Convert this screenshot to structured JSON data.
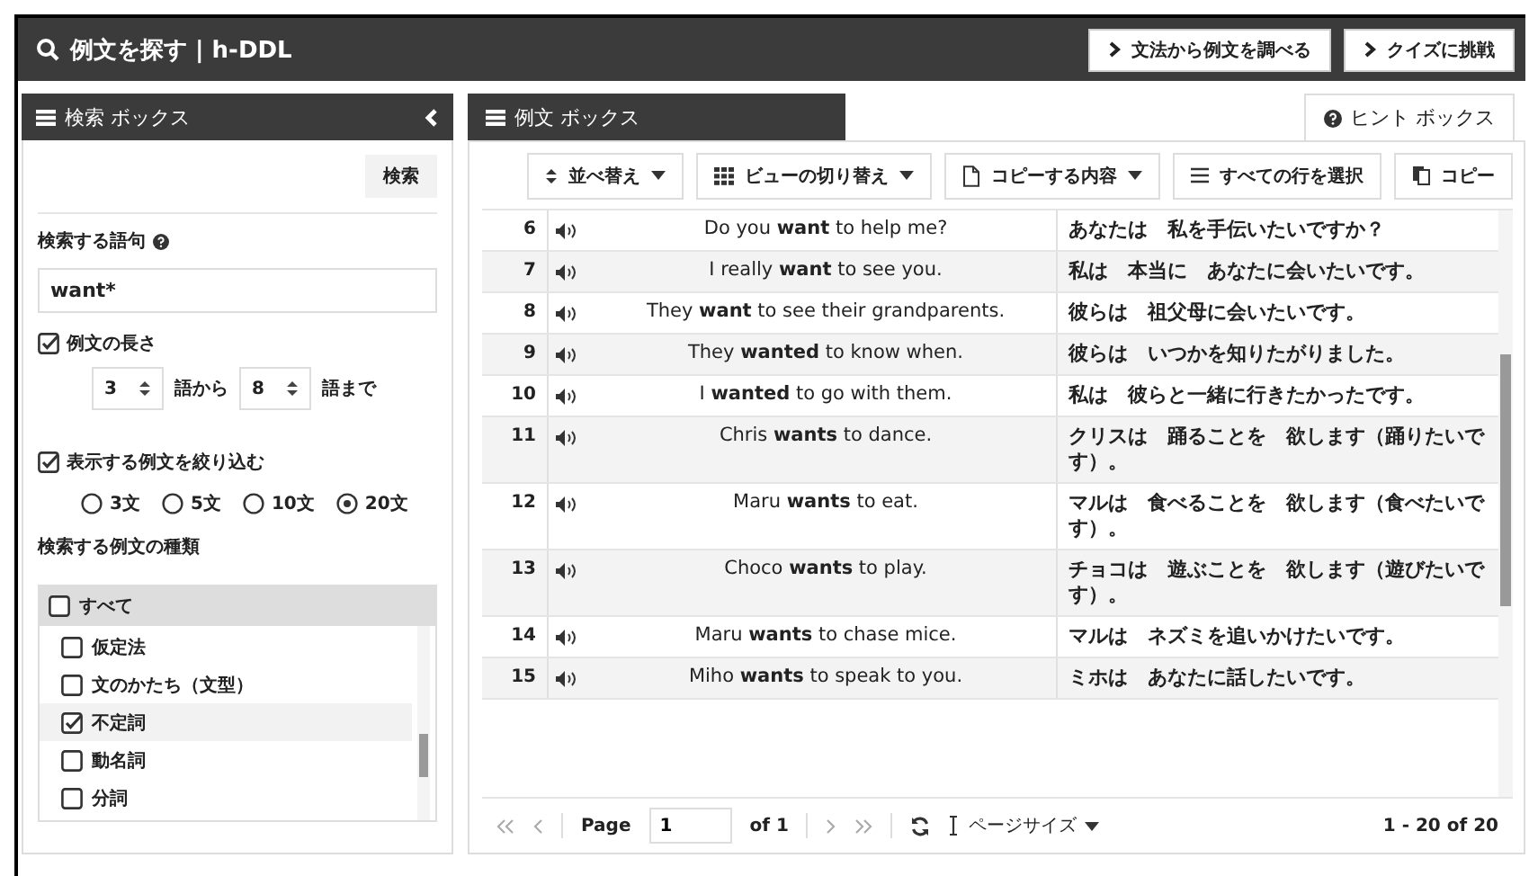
{
  "title": "例文を探す | h-DDL",
  "header_buttons": [
    "文法から例文を調べる",
    "クイズに挑戦"
  ],
  "search_panel": {
    "title": "検索 ボックス",
    "search_button": "検索",
    "term_label": "検索する語句",
    "term_value": "want*",
    "length": {
      "label": "例文の長さ",
      "checked": true,
      "from": "3",
      "from_unit": "語から",
      "to": "8",
      "to_unit": "語まで"
    },
    "limit": {
      "label": "表示する例文を絞り込む",
      "checked": true,
      "options": [
        {
          "label": "3文",
          "selected": false
        },
        {
          "label": "5文",
          "selected": false
        },
        {
          "label": "10文",
          "selected": false
        },
        {
          "label": "20文",
          "selected": true
        }
      ]
    },
    "types_label": "検索する例文の種類",
    "types_all": {
      "label": "すべて",
      "checked": false
    },
    "types": [
      {
        "label": "仮定法",
        "checked": false
      },
      {
        "label": "文のかたち（文型）",
        "checked": false
      },
      {
        "label": "不定詞",
        "checked": true
      },
      {
        "label": "動名詞",
        "checked": false
      },
      {
        "label": "分詞",
        "checked": false
      }
    ]
  },
  "results_panel": {
    "tabs": [
      {
        "label": "例文 ボックス",
        "selected": true
      },
      {
        "label": "ヒント ボックス",
        "selected": false
      }
    ],
    "toolbar": [
      {
        "label": "並べ替え",
        "kind": "sort",
        "menu": true
      },
      {
        "label": "ビューの切り替え",
        "kind": "view",
        "menu": true
      },
      {
        "label": "コピーする内容",
        "kind": "document",
        "menu": true
      },
      {
        "label": "すべての行を選択",
        "kind": "lines",
        "menu": false
      },
      {
        "label": "コピー",
        "kind": "copy",
        "menu": false
      }
    ],
    "rows": [
      {
        "num": "6",
        "en": "Do you **want** to help me?",
        "ja": "あなたは　私を手伝いたいですか？"
      },
      {
        "num": "7",
        "en": "I really **want** to see you.",
        "ja": "私は　本当に　あなたに会いたいです。"
      },
      {
        "num": "8",
        "en": "They **want** to see their grandparents.",
        "ja": "彼らは　祖父母に会いたいです。"
      },
      {
        "num": "9",
        "en": "They **wanted** to know when.",
        "ja": "彼らは　いつかを知りたがりました。"
      },
      {
        "num": "10",
        "en": "I **wanted** to go with them.",
        "ja": "私は　彼らと一緒に行きたかったです。"
      },
      {
        "num": "11",
        "en": "Chris **wants** to dance.",
        "ja": "クリスは　踊ることを　欲します（踊りたいです）。"
      },
      {
        "num": "12",
        "en": "Maru **wants** to eat.",
        "ja": "マルは　食べることを　欲します（食べたいです）。"
      },
      {
        "num": "13",
        "en": "Choco **wants** to play.",
        "ja": "チョコは　遊ぶことを　欲します（遊びたいです）。"
      },
      {
        "num": "14",
        "en": "Maru **wants** to chase mice.",
        "ja": "マルは　ネズミを追いかけたいです。"
      },
      {
        "num": "15",
        "en": "Miho **wants** to speak to you.",
        "ja": "ミホは　あなたに話したいです。"
      }
    ],
    "pager": {
      "page_label": "Page",
      "page": "1",
      "of": "of 1",
      "page_size": "ページサイズ",
      "range": "1 - 20 of 20"
    }
  }
}
